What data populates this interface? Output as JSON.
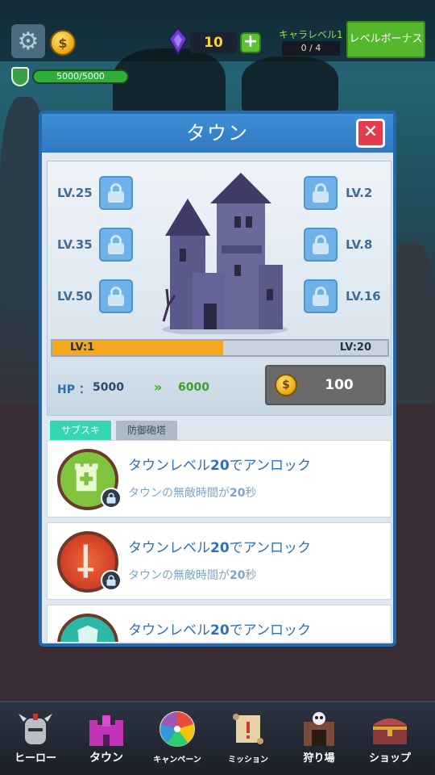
{
  "hud": {
    "gem_count": "10",
    "chara_level_label": "キャラレベル1",
    "chara_progress": "0 / 4",
    "level_bonus_button": "レベルボーナス",
    "hp_text": "5000/5000"
  },
  "modal": {
    "title": "タウン",
    "close_glyph": "✕",
    "locks_left": [
      {
        "level": "LV.25"
      },
      {
        "level": "LV.35"
      },
      {
        "level": "LV.50"
      }
    ],
    "locks_right": [
      {
        "level": "LV.2"
      },
      {
        "level": "LV.8"
      },
      {
        "level": "LV.16"
      }
    ],
    "xp": {
      "from": "LV:1",
      "to": "LV:20",
      "progress_fraction": 0.51
    },
    "hp_label": "HP",
    "hp_colon": "：",
    "hp_current": "5000",
    "hp_next_arrows": "»",
    "hp_next": "6000",
    "upgrade_price": "100",
    "tabs": [
      {
        "label": "サブスキ",
        "active": true
      },
      {
        "label": "防御砲塔",
        "active": false
      }
    ],
    "items": [
      {
        "title_pre": "タウンレベル",
        "title_num": "20",
        "title_post": "でアンロック",
        "sub_pre": "タウンの無敵時間が",
        "sub_num": "20",
        "sub_post": "秒",
        "icon": "tower-heal-icon",
        "color": "#7fc33e"
      },
      {
        "title_pre": "タウンレベル",
        "title_num": "20",
        "title_post": "でアンロック",
        "sub_pre": "タウンの無敵時間が",
        "sub_num": "20",
        "sub_post": "秒",
        "icon": "sword-icon",
        "color": "#d9412a"
      },
      {
        "title_pre": "タウンレベル",
        "title_num": "20",
        "title_post": "でアンロック",
        "sub_pre": "",
        "sub_num": "",
        "sub_post": "",
        "icon": "shield-icon",
        "color": "#2bb8a6"
      }
    ]
  },
  "nav": [
    {
      "label": "ヒーロー",
      "icon": "knight-helmet-icon"
    },
    {
      "label": "タウン",
      "icon": "castle-icon"
    },
    {
      "label": "キャンペーン",
      "icon": "wheel-icon"
    },
    {
      "label": "ミッション",
      "icon": "scroll-icon"
    },
    {
      "label": "狩り場",
      "icon": "skull-gate-icon"
    },
    {
      "label": "ショップ",
      "icon": "chest-icon"
    }
  ]
}
